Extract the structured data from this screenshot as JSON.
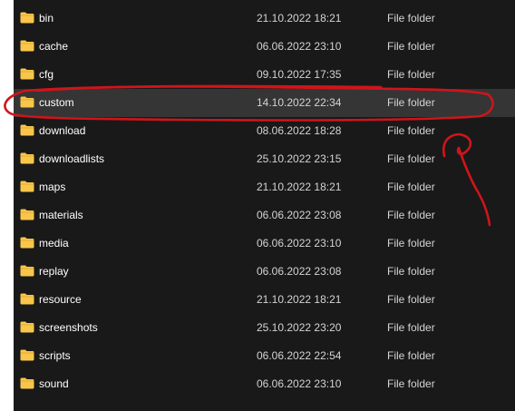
{
  "file_list": {
    "rows": [
      {
        "name": "bin",
        "date": "21.10.2022 18:21",
        "type": "File folder"
      },
      {
        "name": "cache",
        "date": "06.06.2022 23:10",
        "type": "File folder"
      },
      {
        "name": "cfg",
        "date": "09.10.2022 17:35",
        "type": "File folder"
      },
      {
        "name": "custom",
        "date": "14.10.2022 22:34",
        "type": "File folder"
      },
      {
        "name": "download",
        "date": "08.06.2022 18:28",
        "type": "File folder"
      },
      {
        "name": "downloadlists",
        "date": "25.10.2022 23:15",
        "type": "File folder"
      },
      {
        "name": "maps",
        "date": "21.10.2022 18:21",
        "type": "File folder"
      },
      {
        "name": "materials",
        "date": "06.06.2022 23:08",
        "type": "File folder"
      },
      {
        "name": "media",
        "date": "06.06.2022 23:10",
        "type": "File folder"
      },
      {
        "name": "replay",
        "date": "06.06.2022 23:08",
        "type": "File folder"
      },
      {
        "name": "resource",
        "date": "21.10.2022 18:21",
        "type": "File folder"
      },
      {
        "name": "screenshots",
        "date": "25.10.2022 23:20",
        "type": "File folder"
      },
      {
        "name": "scripts",
        "date": "06.06.2022 22:54",
        "type": "File folder"
      },
      {
        "name": "sound",
        "date": "06.06.2022 23:10",
        "type": "File folder"
      }
    ],
    "selected_index": 3,
    "row_icon": "folder-icon"
  },
  "colors": {
    "background": "#191919",
    "selected_row": "#353535",
    "folder": "#f8c64a",
    "annotation": "#d0141b"
  }
}
